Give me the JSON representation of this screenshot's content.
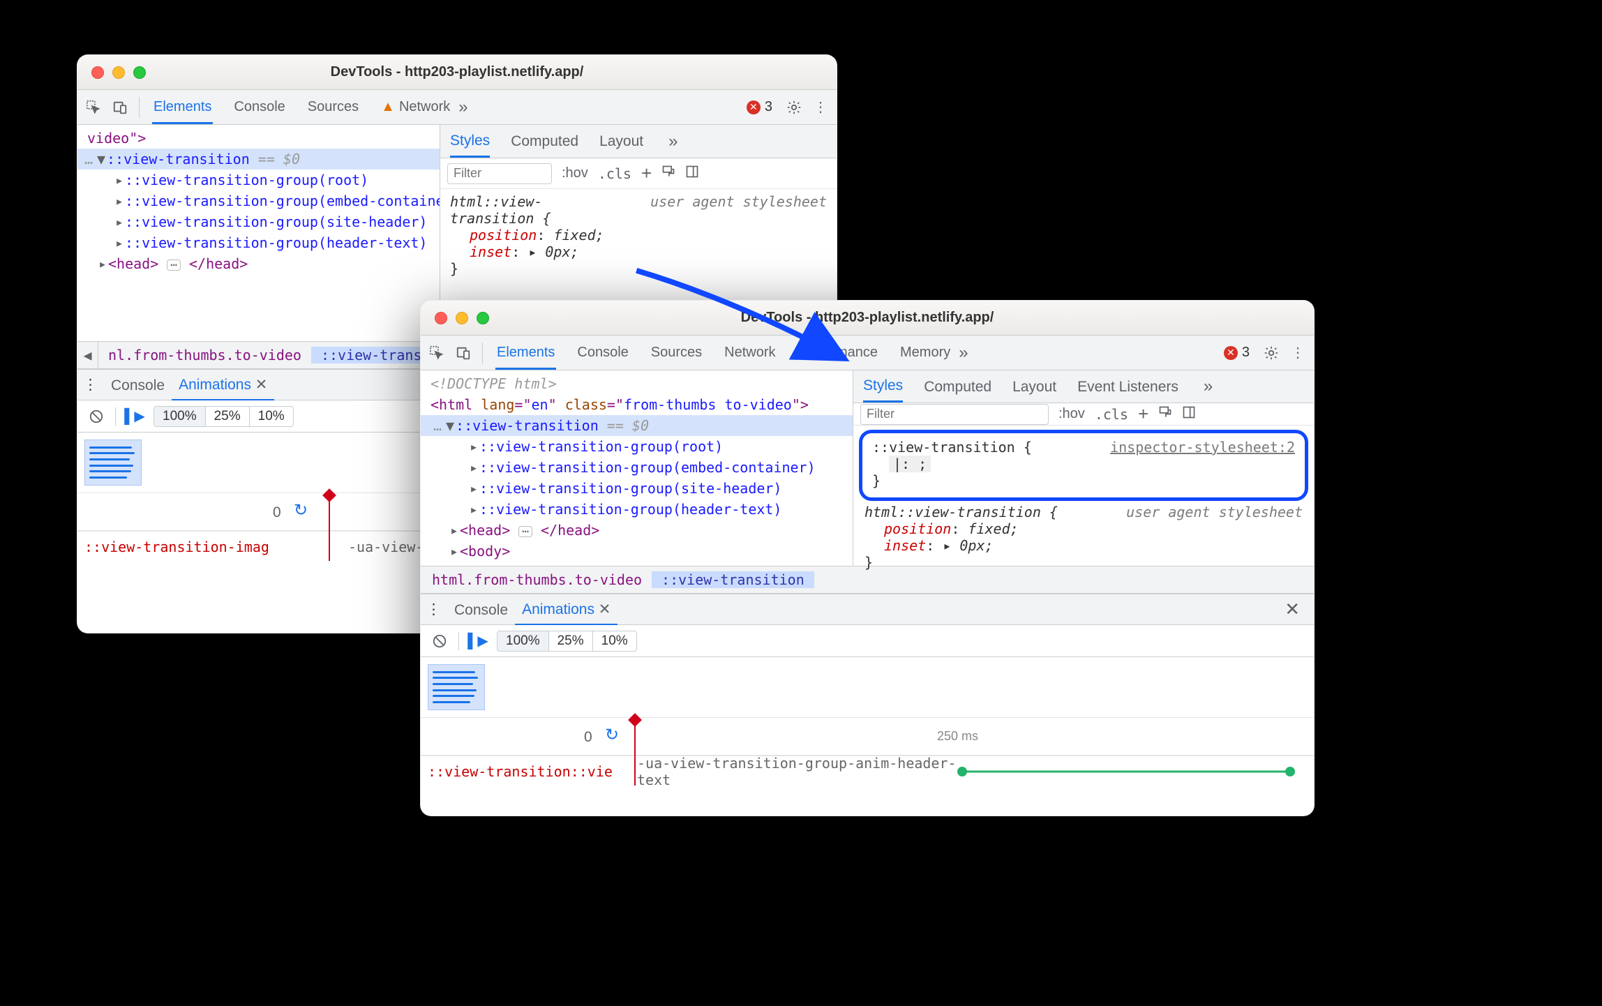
{
  "window1": {
    "title": "DevTools - http203-playlist.netlify.app/",
    "tabs": [
      "Elements",
      "Console",
      "Sources",
      "Network"
    ],
    "active_tab": "Elements",
    "error_count": "3",
    "dom": {
      "video_close": "video\">",
      "vt_selected": "::view-transition",
      "vt_suffix": " == $0",
      "groups": [
        "::view-transition-group(root)",
        "::view-transition-group(embed-container)",
        "::view-transition-group(site-header)",
        "::view-transition-group(header-text)"
      ],
      "head_open": "<head>",
      "head_close": "</head>"
    },
    "breadcrumbs": {
      "left": "nl.from-thumbs.to-video",
      "right": "::view-transition"
    },
    "styles": {
      "tabs": [
        "Styles",
        "Computed",
        "Layout"
      ],
      "filter_placeholder": "Filter",
      "toolbar": [
        ":hov",
        ".cls"
      ],
      "rule": {
        "selector": "html::view-transition {",
        "source": "user agent stylesheet",
        "props": [
          {
            "name": "position",
            "value": "fixed;"
          },
          {
            "name": "inset",
            "value": "▸ 0px;"
          }
        ],
        "close": "}"
      }
    },
    "drawer": {
      "tabs": [
        "Console",
        "Animations"
      ],
      "speeds": [
        "100%",
        "25%",
        "10%"
      ],
      "zero": "0",
      "selector_label": "::view-transition-imag",
      "track_name": "-ua-view-tr"
    }
  },
  "window2": {
    "title": "DevTools - http203-playlist.netlify.app/",
    "tabs": [
      "Elements",
      "Console",
      "Sources",
      "Network",
      "Performance",
      "Memory"
    ],
    "active_tab": "Elements",
    "error_count": "3",
    "dom": {
      "doctype": "<!DOCTYPE html>",
      "html_open": "<html lang=\"en\" class=\"from-thumbs to-video\">",
      "vt_selected": "::view-transition",
      "vt_suffix": " == $0",
      "groups": [
        "::view-transition-group(root)",
        "::view-transition-group(embed-container)",
        "::view-transition-group(site-header)",
        "::view-transition-group(header-text)"
      ],
      "head_open": "<head>",
      "head_close": "</head>",
      "body_open": "<body>"
    },
    "breadcrumbs": {
      "left": "html.from-thumbs.to-video",
      "right": "::view-transition"
    },
    "styles": {
      "tabs": [
        "Styles",
        "Computed",
        "Layout",
        "Event Listeners"
      ],
      "filter_placeholder": "Filter",
      "toolbar": [
        ":hov",
        ".cls"
      ],
      "editing": {
        "selector": "::view-transition {",
        "source": "inspector-stylesheet:2",
        "stub": "|:  ;",
        "close": "}"
      },
      "rule": {
        "selector": "html::view-transition {",
        "source": "user agent stylesheet",
        "props": [
          {
            "name": "position",
            "value": "fixed;"
          },
          {
            "name": "inset",
            "value": "▸ 0px;"
          }
        ],
        "close": "}"
      }
    },
    "drawer": {
      "tabs": [
        "Console",
        "Animations"
      ],
      "speeds": [
        "100%",
        "25%",
        "10%"
      ],
      "zero": "0",
      "ms_250": "250 ms",
      "selector_label": "::view-transition::vie",
      "track_name": "-ua-view-transition-group-anim-header-text"
    }
  }
}
